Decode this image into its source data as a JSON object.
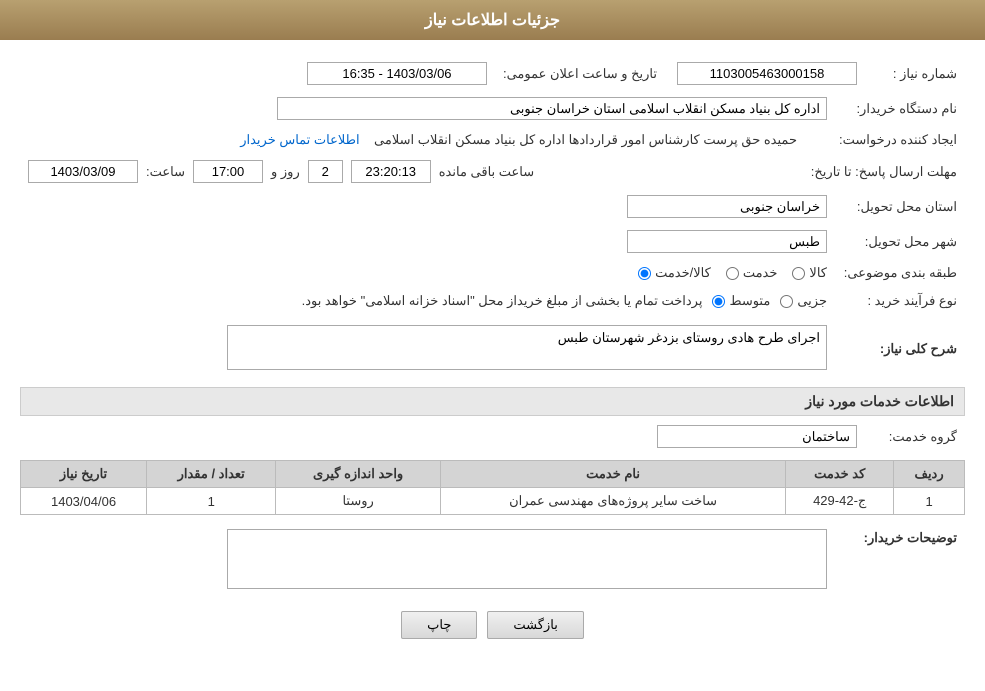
{
  "page": {
    "title": "جزئیات اطلاعات نیاز"
  },
  "header": {
    "label": "جزئیات اطلاعات نیاز"
  },
  "fields": {
    "need_number_label": "شماره نیاز :",
    "need_number_value": "1103005463000158",
    "announce_date_label": "تاریخ و ساعت اعلان عمومی:",
    "announce_date_value": "1403/03/06 - 16:35",
    "buyer_org_label": "نام دستگاه خریدار:",
    "buyer_org_value": "اداره کل بنیاد مسکن انقلاب اسلامی استان خراسان جنوبی",
    "creator_label": "ایجاد کننده درخواست:",
    "creator_value": "حمیده حق پرست کارشناس امور قراردادها اداره کل بنیاد مسکن انقلاب اسلامی",
    "contact_link": "اطلاعات تماس خریدار",
    "deadline_label": "مهلت ارسال پاسخ: تا تاریخ:",
    "deadline_date": "1403/03/09",
    "deadline_time_label": "ساعت:",
    "deadline_time": "17:00",
    "deadline_days_label": "روز و",
    "deadline_days": "2",
    "remaining_label": "ساعت باقی مانده",
    "remaining_time": "23:20:13",
    "province_label": "استان محل تحویل:",
    "province_value": "خراسان جنوبی",
    "city_label": "شهر محل تحویل:",
    "city_value": "طبس",
    "category_label": "طبقه بندی موضوعی:",
    "category_kala": "کالا",
    "category_khedmat": "خدمت",
    "category_kala_khedmat": "کالا/خدمت",
    "process_label": "نوع فرآیند خرید :",
    "process_jozvi": "جزیی",
    "process_motavaset": "متوسط",
    "process_desc": "پرداخت تمام یا بخشی از مبلغ خریداز محل \"اسناد خزانه اسلامی\" خواهد بود.",
    "general_desc_label": "شرح کلی نیاز:",
    "general_desc_value": "اجرای طرح هادی روستای بزدغر شهرستان طبس",
    "services_section_label": "اطلاعات خدمات مورد نیاز",
    "service_group_label": "گروه خدمت:",
    "service_group_value": "ساختمان",
    "table": {
      "col_row": "ردیف",
      "col_code": "کد خدمت",
      "col_name": "نام خدمت",
      "col_unit": "واحد اندازه گیری",
      "col_qty": "تعداد / مقدار",
      "col_date": "تاریخ نیاز",
      "rows": [
        {
          "row": "1",
          "code": "ج-42-429",
          "name": "ساخت سایر پروژه‌های مهندسی عمران",
          "unit": "روستا",
          "qty": "1",
          "date": "1403/04/06"
        }
      ]
    },
    "buyer_desc_label": "توضیحات خریدار:",
    "buyer_desc_value": ""
  },
  "buttons": {
    "print_label": "چاپ",
    "back_label": "بازگشت"
  }
}
